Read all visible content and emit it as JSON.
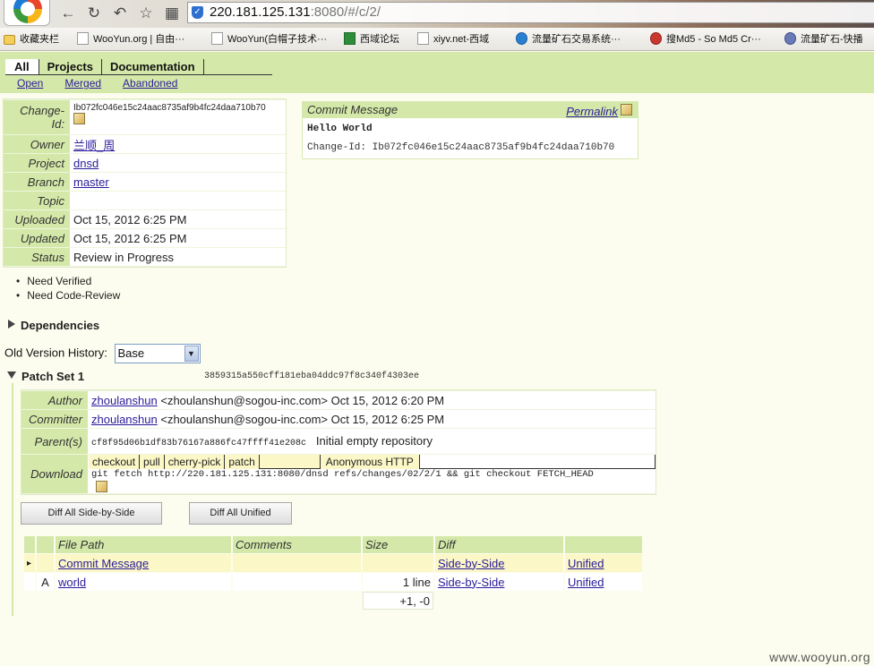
{
  "browser": {
    "url_host": "220.181.125.131",
    "url_rest": ":8080/#/c/2/",
    "bookmarks": [
      {
        "label": "收藏夹栏",
        "icon": "folder"
      },
      {
        "label": "WooYun.org | 自由···",
        "icon": "page"
      },
      {
        "label": "WooYun(白帽子技术···",
        "icon": "page"
      },
      {
        "label": "西域论坛",
        "icon": "green"
      },
      {
        "label": "xiyv.net-西域",
        "icon": "page"
      },
      {
        "label": "流量矿石交易系统···",
        "icon": "bluewave"
      },
      {
        "label": "搜Md5 - So Md5 Cr···",
        "icon": "red"
      },
      {
        "label": "流量矿石-快播",
        "icon": "person"
      }
    ]
  },
  "nav": {
    "tabs": [
      "All",
      "Projects",
      "Documentation"
    ],
    "subtabs": [
      "Open",
      "Merged",
      "Abandoned"
    ]
  },
  "change": {
    "change_id_label": "Change-Id:",
    "change_id": "Ib072fc046e15c24aac8735af9b4fc24daa710b70",
    "owner_label": "Owner",
    "owner": "兰顺_周",
    "project_label": "Project",
    "project": "dnsd",
    "branch_label": "Branch",
    "branch": "master",
    "topic_label": "Topic",
    "topic": "",
    "uploaded_label": "Uploaded",
    "uploaded": "Oct 15, 2012 6:25 PM",
    "updated_label": "Updated",
    "updated": "Oct 15, 2012 6:25 PM",
    "status_label": "Status",
    "status": "Review in Progress"
  },
  "commit_message": {
    "header": "Commit Message",
    "permalink": "Permalink",
    "subject": "Hello World",
    "footer": "Change-Id: Ib072fc046e15c24aac8735af9b4fc24daa710b70"
  },
  "approvals": [
    "Need Verified",
    "Need Code-Review"
  ],
  "dependencies_label": "Dependencies",
  "old_version": {
    "label": "Old Version History:",
    "selected": "Base"
  },
  "patch_set": {
    "title": "Patch Set 1",
    "revision": "3859315a550cff181eba04ddc97f8c340f4303ee",
    "author_label": "Author",
    "author_name": "zhoulanshun",
    "author_rest": "<zhoulanshun@sogou-inc.com> Oct 15, 2012 6:20 PM",
    "committer_label": "Committer",
    "committer_name": "zhoulanshun",
    "committer_rest": "<zhoulanshun@sogou-inc.com> Oct 15, 2012 6:25 PM",
    "parents_label": "Parent(s)",
    "parent_hash": "cf8f95d06b1df83b76167a886fc47ffff41e208c",
    "parent_msg": "Initial empty repository",
    "download_label": "Download",
    "download_tabs": [
      "checkout",
      "pull",
      "cherry-pick",
      "patch"
    ],
    "download_protocol": "Anonymous HTTP",
    "download_cmd": "git fetch http://220.181.125.131:8080/dnsd refs/changes/02/2/1 && git checkout FETCH_HEAD"
  },
  "buttons": {
    "diff_all_sbs": "Diff All Side-by-Side",
    "diff_all_unified": "Diff All Unified"
  },
  "files": {
    "headers": [
      "File Path",
      "Comments",
      "Size",
      "Diff"
    ],
    "rows": [
      {
        "marker": "▸",
        "path": "Commit Message",
        "comments": "",
        "size": "",
        "sbs": "Side-by-Side",
        "unified": "Unified"
      },
      {
        "marker": "A",
        "path": "world",
        "comments": "",
        "size": "1 line",
        "sbs": "Side-by-Side",
        "unified": "Unified"
      }
    ],
    "total": "+1, -0"
  },
  "watermark": "www.wooyun.org"
}
